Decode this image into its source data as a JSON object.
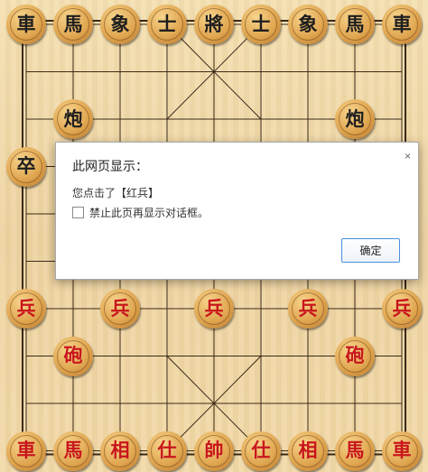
{
  "board": {
    "palette": {
      "wood": "#f0d9a8",
      "line": "#3a2a18",
      "red_piece_text": "#c8161d",
      "black_piece_text": "#1e1e1e"
    },
    "pieces": [
      {
        "label": "車",
        "side": "black",
        "col": 0,
        "row": 0
      },
      {
        "label": "馬",
        "side": "black",
        "col": 1,
        "row": 0
      },
      {
        "label": "象",
        "side": "black",
        "col": 2,
        "row": 0
      },
      {
        "label": "士",
        "side": "black",
        "col": 3,
        "row": 0
      },
      {
        "label": "將",
        "side": "black",
        "col": 4,
        "row": 0
      },
      {
        "label": "士",
        "side": "black",
        "col": 5,
        "row": 0
      },
      {
        "label": "象",
        "side": "black",
        "col": 6,
        "row": 0
      },
      {
        "label": "馬",
        "side": "black",
        "col": 7,
        "row": 0
      },
      {
        "label": "車",
        "side": "black",
        "col": 8,
        "row": 0
      },
      {
        "label": "炮",
        "side": "black",
        "col": 1,
        "row": 2
      },
      {
        "label": "炮",
        "side": "black",
        "col": 7,
        "row": 2
      },
      {
        "label": "卒",
        "side": "black",
        "col": 0,
        "row": 3
      },
      {
        "label": "兵",
        "side": "red",
        "col": 0,
        "row": 6
      },
      {
        "label": "兵",
        "side": "red",
        "col": 2,
        "row": 6
      },
      {
        "label": "兵",
        "side": "red",
        "col": 4,
        "row": 6
      },
      {
        "label": "兵",
        "side": "red",
        "col": 6,
        "row": 6
      },
      {
        "label": "兵",
        "side": "red",
        "col": 8,
        "row": 6
      },
      {
        "label": "砲",
        "side": "red",
        "col": 1,
        "row": 7
      },
      {
        "label": "砲",
        "side": "red",
        "col": 7,
        "row": 7
      },
      {
        "label": "車",
        "side": "red",
        "col": 0,
        "row": 9
      },
      {
        "label": "馬",
        "side": "red",
        "col": 1,
        "row": 9
      },
      {
        "label": "相",
        "side": "red",
        "col": 2,
        "row": 9
      },
      {
        "label": "仕",
        "side": "red",
        "col": 3,
        "row": 9
      },
      {
        "label": "帥",
        "side": "red",
        "col": 4,
        "row": 9
      },
      {
        "label": "仕",
        "side": "red",
        "col": 5,
        "row": 9
      },
      {
        "label": "相",
        "side": "red",
        "col": 6,
        "row": 9
      },
      {
        "label": "馬",
        "side": "red",
        "col": 7,
        "row": 9
      },
      {
        "label": "車",
        "side": "red",
        "col": 8,
        "row": 9
      }
    ]
  },
  "dialog": {
    "title": "此网页显示：",
    "close_label": "×",
    "message": "您点击了【红兵】",
    "checkbox_label": "禁止此页再显示对话框。",
    "checkbox_checked": false,
    "ok_label": "确定"
  }
}
